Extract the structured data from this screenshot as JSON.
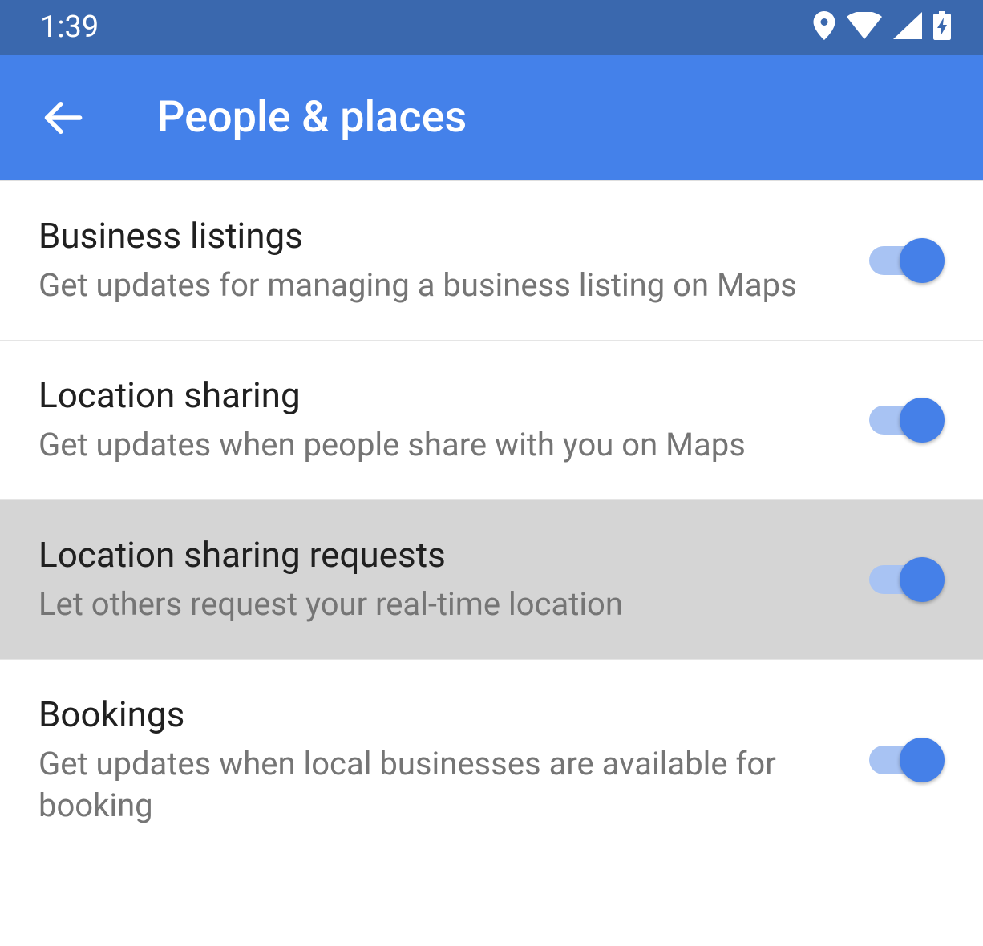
{
  "statusBar": {
    "time": "1:39"
  },
  "header": {
    "title": "People & places"
  },
  "settings": [
    {
      "title": "Business listings",
      "description": "Get updates for managing a business listing on Maps",
      "enabled": true,
      "highlighted": false
    },
    {
      "title": "Location sharing",
      "description": "Get updates when people share with you on Maps",
      "enabled": true,
      "highlighted": false
    },
    {
      "title": "Location sharing requests",
      "description": "Let others request your real-time location",
      "enabled": true,
      "highlighted": true
    },
    {
      "title": "Bookings",
      "description": "Get updates when local businesses are available for booking",
      "enabled": true,
      "highlighted": false
    }
  ]
}
